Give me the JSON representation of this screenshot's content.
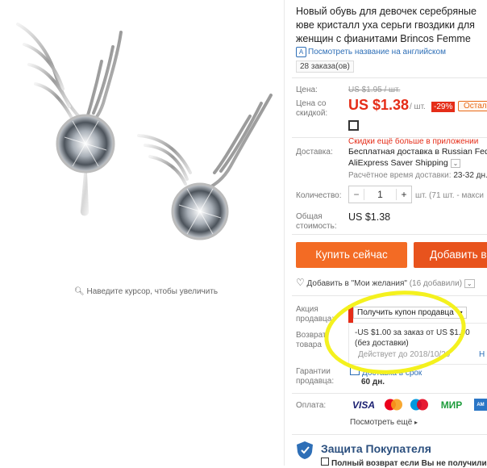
{
  "gallery": {
    "zoom_hint": "Наведите курсор, чтобы увеличить"
  },
  "product": {
    "title": "Новый обувь для девочек серебряные юве кристалл уха серьги гвоздики для женщин с фианитами Brincos Femme",
    "translate_link": "Посмотреть название на английском",
    "orders": "28 заказа(ов)"
  },
  "price": {
    "price_label": "Цена:",
    "old_price": "US $1.95 / шт.",
    "discount_label_line1": "Цена со",
    "discount_label_line2": "скидкой:",
    "new_price": "US $1.38",
    "unit": "/ шт.",
    "discount_badge": "-29%",
    "stock_badge": "Остало",
    "app_discount": "Скидки ещё больше в приложении"
  },
  "shipping": {
    "label": "Доставка:",
    "method": "Бесплатная доставка в Russian Fede",
    "service": "AliExpress Saver Shipping",
    "eta_label": "Расчётное время доставки:",
    "eta_value": "23-32 дн."
  },
  "quantity": {
    "label": "Количество:",
    "minus": "−",
    "value": "1",
    "plus": "+",
    "available": "шт. (71 шт. - макси"
  },
  "total": {
    "label_line1": "Общая",
    "label_line2": "стоимость:",
    "value": "US $1.38"
  },
  "buttons": {
    "buy_now": "Купить сейчас",
    "add_to_cart": "Добавить в"
  },
  "wishlist": {
    "text": "Добавить в \"Мои желания\"",
    "count": "(16 добавили)"
  },
  "coupon": {
    "label_line1": "Акция",
    "label_line2": "продавца:",
    "select_text": "Получить купон продавца",
    "offer_line1": "-US $1.00 за заказ от US $1.00",
    "offer_line2": "(без доставки)",
    "valid_until": "Действует до 2018/10/29",
    "right_link": "Н"
  },
  "returns": {
    "label_line1": "Возврат",
    "label_line2": "товара"
  },
  "guarantee": {
    "label_line1": "Гарантии",
    "label_line2": "продавца:",
    "delivery_text": "Доставка в срок",
    "days": "60 дн."
  },
  "payment": {
    "label": "Оплата:",
    "methods": [
      "VISA",
      "MC",
      "Maestro",
      "МИР",
      "AMEX"
    ],
    "see_more": "Посмотреть ещё"
  },
  "protection": {
    "title": "Защита Покупателя",
    "refund_text": "Полный возврат если Вы не получили"
  },
  "colors": {
    "accent": "#e52d18",
    "buy_button": "#f36b24",
    "link": "#2e6fb7",
    "highlight": "#f4f11e"
  }
}
